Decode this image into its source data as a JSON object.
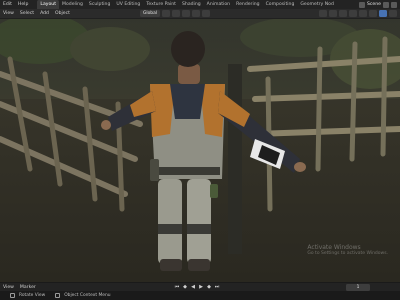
{
  "topbar": {
    "menus": [
      "Edit",
      "Help"
    ],
    "workspace_tabs": [
      {
        "label": "Layout",
        "active": true
      },
      {
        "label": "Modeling",
        "active": false
      },
      {
        "label": "Sculpting",
        "active": false
      },
      {
        "label": "UV Editing",
        "active": false
      },
      {
        "label": "Texture Paint",
        "active": false
      },
      {
        "label": "Shading",
        "active": false
      },
      {
        "label": "Animation",
        "active": false
      },
      {
        "label": "Rendering",
        "active": false
      },
      {
        "label": "Compositing",
        "active": false
      },
      {
        "label": "Geometry Nod",
        "active": false
      }
    ],
    "scene_label": "Scene"
  },
  "header": {
    "menus": [
      "View",
      "Select",
      "Add",
      "Object"
    ],
    "transform_orientation": "Global"
  },
  "viewport": {
    "watermark_line1": "Activate Windows",
    "watermark_line2": "Go to Settings to activate Windows."
  },
  "timeline": {
    "menus": [
      "View",
      "Marker"
    ],
    "current_frame": "1"
  },
  "statusbar": {
    "left_hint": "Rotate View",
    "mid_hint": "Object Context Menu"
  },
  "colors": {
    "accent": "#4772b3",
    "topbar_bg": "#232323",
    "header_bg": "#2b2b2b"
  }
}
